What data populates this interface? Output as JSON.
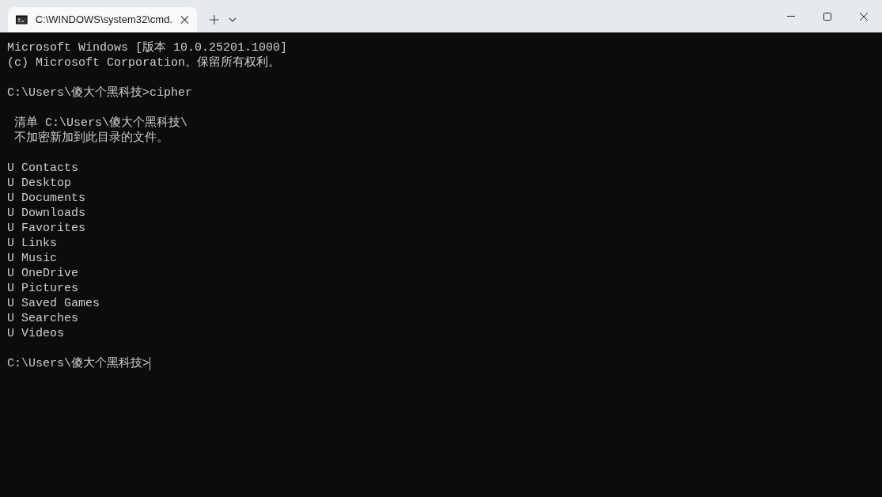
{
  "tab": {
    "title": "C:\\WINDOWS\\system32\\cmd.",
    "selected": true
  },
  "terminal": {
    "blocks": [
      [
        "Microsoft Windows [版本 10.0.25201.1000]",
        "(c) Microsoft Corporation。保留所有权利。"
      ],
      [
        "C:\\Users\\傻大个黑科技>cipher"
      ],
      [
        " 清单 C:\\Users\\傻大个黑科技\\",
        " 不加密新加到此目录的文件。"
      ],
      [
        "U Contacts",
        "U Desktop",
        "U Documents",
        "U Downloads",
        "U Favorites",
        "U Links",
        "U Music",
        "U OneDrive",
        "U Pictures",
        "U Saved Games",
        "U Searches",
        "U Videos"
      ]
    ],
    "prompt": "C:\\Users\\傻大个黑科技>"
  }
}
